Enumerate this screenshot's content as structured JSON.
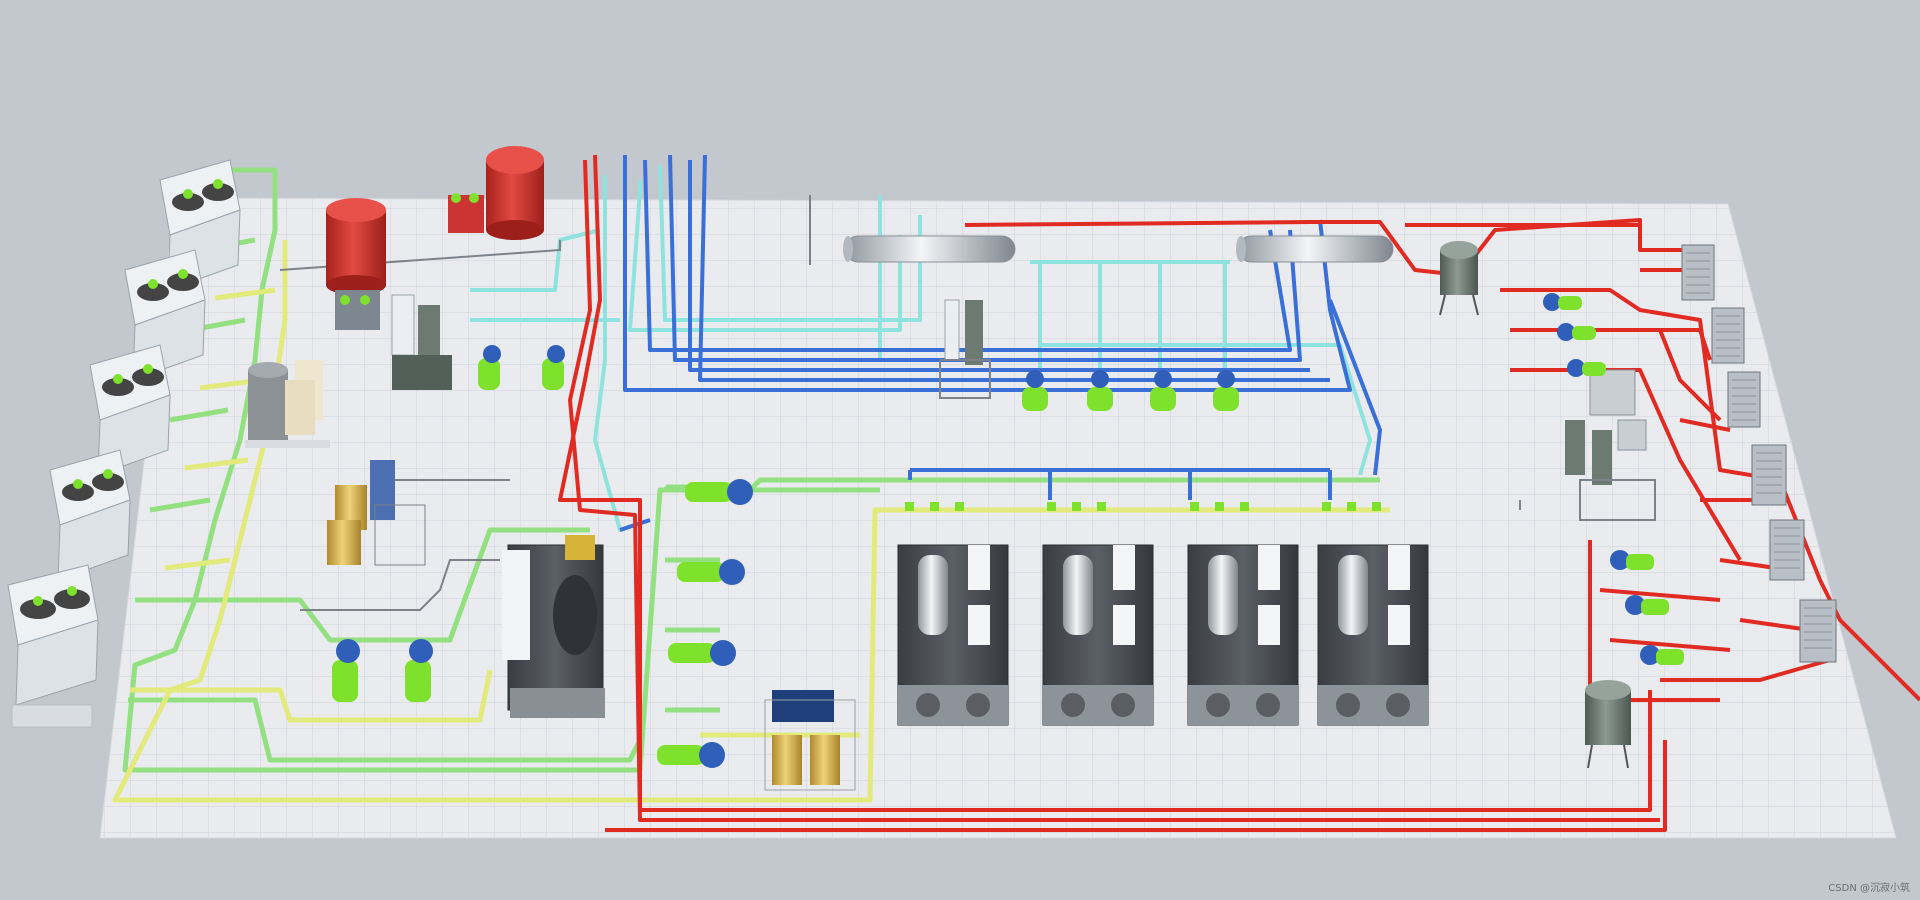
{
  "colors": {
    "background": "#c3c7ce",
    "floor": "#e9ebee",
    "hot_water_pipe": "#e02a22",
    "chilled_supply_pipe": "#3a6fd8",
    "chilled_return_pipe": "#8fe3df",
    "cooling_water_supply": "#e3ea7c",
    "cooling_water_return": "#93e081",
    "pump_motor": "#7ee12c",
    "pump_body": "#2f5fb8",
    "chiller_body": "#4a4d52",
    "tank_red": "#d8322e",
    "tank_yellow": "#e5c45a",
    "tank_gray": "#6d7a72"
  },
  "equipment": {
    "cooling_towers": 5,
    "centrifugal_chillers": 4,
    "screw_chiller": 1,
    "chilled_water_pumps": 4,
    "cooling_water_pumps": 4,
    "aux_pumps": 4,
    "heat_exchangers": 6,
    "heating_pumps": 6,
    "manifolds": 2,
    "expansion_tanks": 2
  },
  "watermark": "CSDN @沉寂小筑"
}
